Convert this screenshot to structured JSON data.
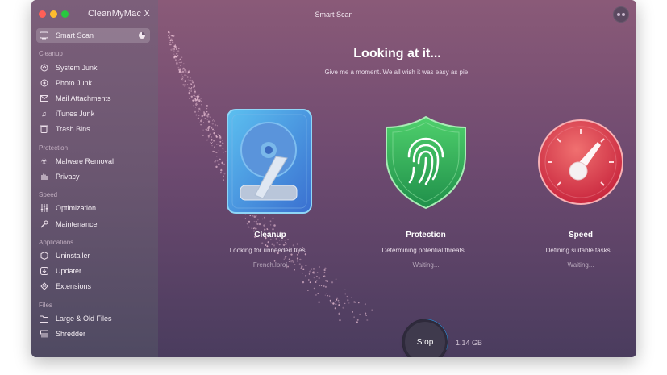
{
  "window": {
    "app_title": "CleanMyMac X",
    "title": "Smart Scan"
  },
  "sidebar": {
    "smart_scan": "Smart Scan",
    "sections": [
      {
        "label": "Cleanup",
        "items": [
          "System Junk",
          "Photo Junk",
          "Mail Attachments",
          "iTunes Junk",
          "Trash Bins"
        ]
      },
      {
        "label": "Protection",
        "items": [
          "Malware Removal",
          "Privacy"
        ]
      },
      {
        "label": "Speed",
        "items": [
          "Optimization",
          "Maintenance"
        ]
      },
      {
        "label": "Applications",
        "items": [
          "Uninstaller",
          "Updater",
          "Extensions"
        ]
      },
      {
        "label": "Files",
        "items": [
          "Large & Old Files",
          "Shredder"
        ]
      }
    ]
  },
  "main": {
    "headline": "Looking at it...",
    "subline": "Give me a moment. We all wish it was easy as pie.",
    "cards": [
      {
        "title": "Cleanup",
        "status": "Looking for unneeded files...",
        "detail": "French.lproj"
      },
      {
        "title": "Protection",
        "status": "Determining potential threats...",
        "detail": "Waiting..."
      },
      {
        "title": "Speed",
        "status": "Defining suitable tasks...",
        "detail": "Waiting..."
      }
    ],
    "stop_label": "Stop",
    "size": "1.14 GB",
    "progress_fraction": 0.3
  },
  "colors": {
    "accent_ring": "#2f9df0",
    "shield": "#2fb55a",
    "gauge": "#e0334a",
    "drive": "#4a9ee0"
  }
}
